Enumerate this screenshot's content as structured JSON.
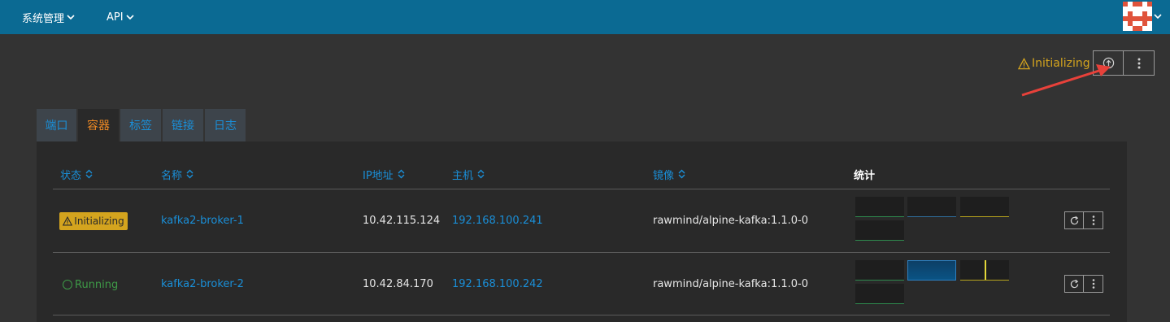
{
  "topnav": {
    "system_label": "系统管理",
    "api_label": "API"
  },
  "header": {
    "status_text": "Initializing",
    "status_color": "#d4a41e",
    "upgrade_icon": "arrow-up-circle-icon",
    "more_icon": "vertical-dots-icon"
  },
  "tabs": [
    {
      "label": "端口",
      "active": false
    },
    {
      "label": "容器",
      "active": true
    },
    {
      "label": "标签",
      "active": false
    },
    {
      "label": "链接",
      "active": false
    },
    {
      "label": "日志",
      "active": false
    }
  ],
  "table": {
    "columns": [
      {
        "label": "状态",
        "sortable": true
      },
      {
        "label": "名称",
        "sortable": true
      },
      {
        "label": "IP地址",
        "sortable": true
      },
      {
        "label": "主机",
        "sortable": true
      },
      {
        "label": "镜像",
        "sortable": true
      },
      {
        "label": "统计",
        "sortable": false
      }
    ],
    "rows": [
      {
        "status": "Initializing",
        "name": "kafka2-broker-1",
        "ip": "10.42.115.124",
        "host": "192.168.100.241",
        "image": "rawmind/alpine-kafka:1.1.0-0"
      },
      {
        "status": "Running",
        "name": "kafka2-broker-2",
        "ip": "10.42.84.170",
        "host": "192.168.100.242",
        "image": "rawmind/alpine-kafka:1.1.0-0"
      }
    ]
  },
  "colors": {
    "topbar": "#0b6a93",
    "link": "#1a8fd8",
    "active_tab": "#f08a24",
    "running": "#3e9a47",
    "initializing": "#d4a41e"
  }
}
